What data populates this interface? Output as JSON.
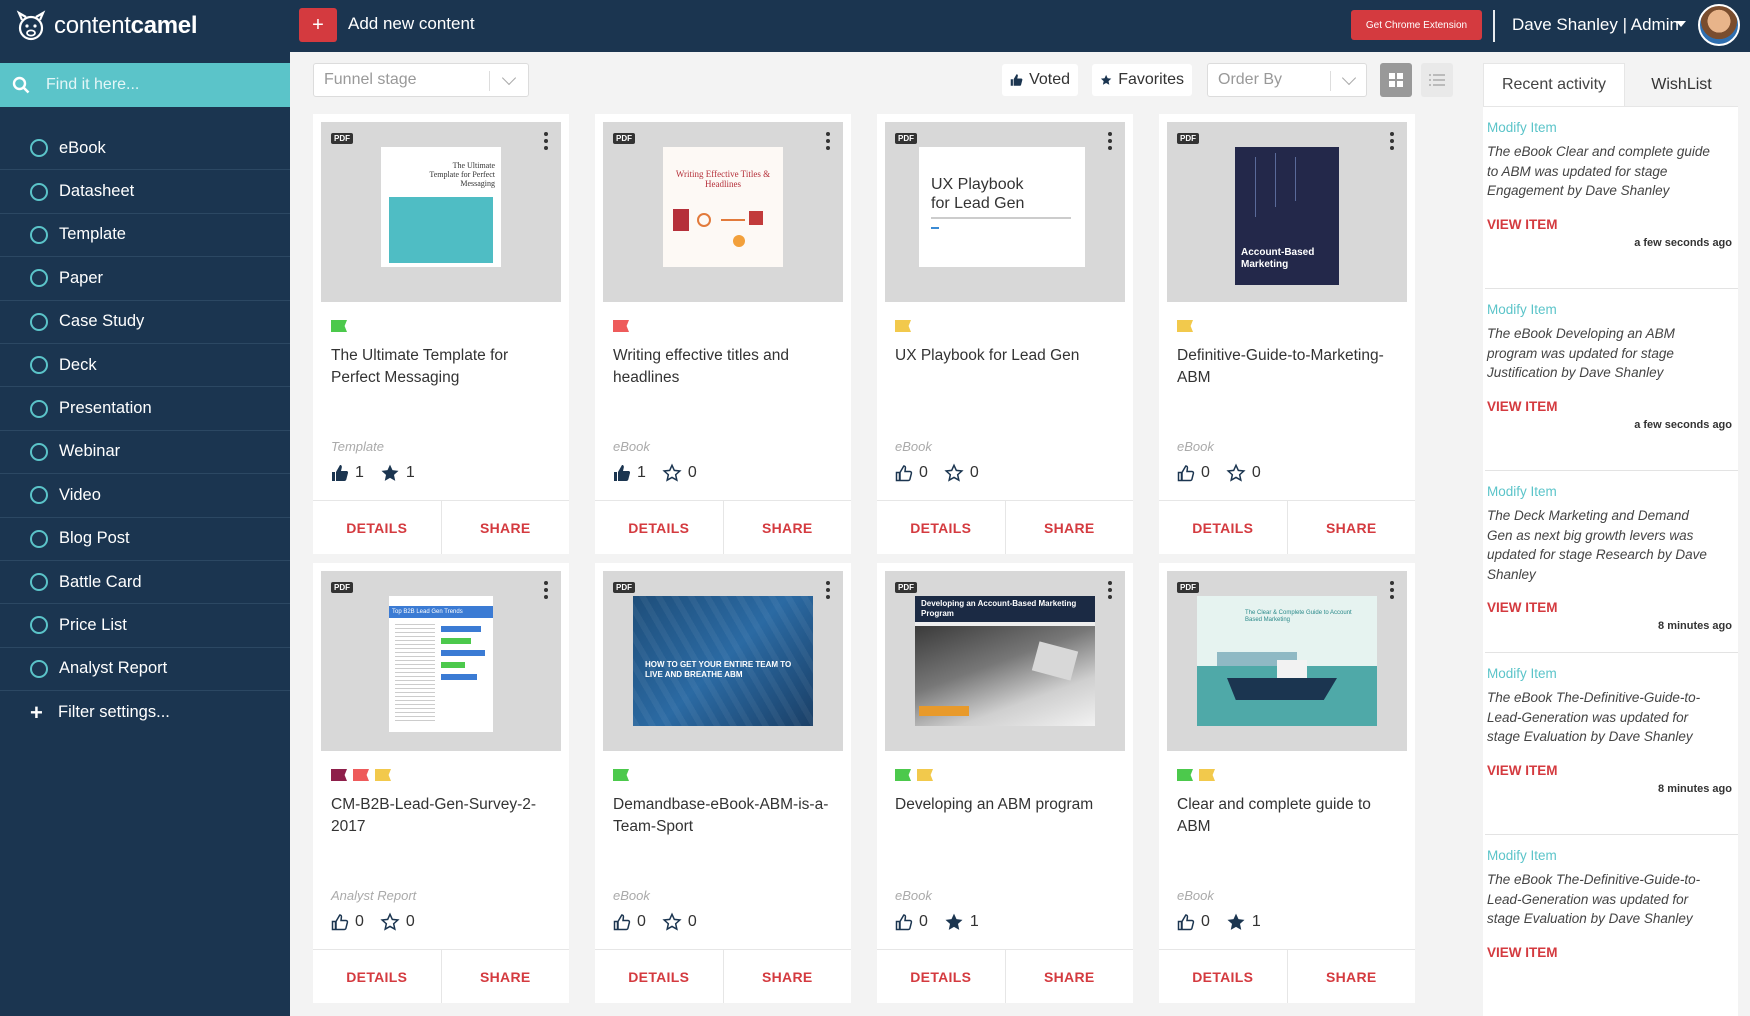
{
  "header": {
    "logo_light": "content",
    "logo_bold": "camel",
    "add_button_icon": "+",
    "add_label": "Add new content",
    "chrome_extension": "Get Chrome Extension",
    "user_label": "Dave Shanley | Admin"
  },
  "sidebar": {
    "search_placeholder": "Find it here...",
    "categories": [
      "eBook",
      "Datasheet",
      "Template",
      "Paper",
      "Case Study",
      "Deck",
      "Presentation",
      "Webinar",
      "Video",
      "Blog Post",
      "Battle Card",
      "Price List",
      "Analyst Report"
    ],
    "filter_settings": "Filter settings..."
  },
  "toolbar": {
    "funnel_stage": "Funnel stage",
    "voted": "Voted",
    "favorites": "Favorites",
    "order_by": "Order By"
  },
  "cards": [
    {
      "file_badge": "PDF",
      "title": "The Ultimate Template for Perfect Messaging",
      "type": "Template",
      "votes": "1",
      "favorites": "1",
      "voted": true,
      "favorited": true,
      "tags": [
        "#4cc94c"
      ],
      "cover_text": "The Ultimate Template for Perfect Messaging",
      "details": "DETAILS",
      "share": "SHARE"
    },
    {
      "file_badge": "PDF",
      "title": "Writing effective titles and headlines",
      "type": "eBook",
      "votes": "1",
      "favorites": "0",
      "voted": true,
      "favorited": false,
      "tags": [
        "#ee5b5b"
      ],
      "cover_text": "Writing Effective Titles & Headlines",
      "details": "DETAILS",
      "share": "SHARE"
    },
    {
      "file_badge": "PDF",
      "title": "UX Playbook for Lead Gen",
      "type": "eBook",
      "votes": "0",
      "favorites": "0",
      "voted": false,
      "favorited": false,
      "tags": [
        "#f2c94c"
      ],
      "cover_text": "UX Playbook for Lead Gen",
      "details": "DETAILS",
      "share": "SHARE"
    },
    {
      "file_badge": "PDF",
      "title": "Definitive-Guide-to-Marketing-ABM",
      "type": "eBook",
      "votes": "0",
      "favorites": "0",
      "voted": false,
      "favorited": false,
      "tags": [
        "#f2c94c"
      ],
      "cover_text": "Account-Based Marketing",
      "details": "DETAILS",
      "share": "SHARE"
    },
    {
      "file_badge": "PDF",
      "title": "CM-B2B-Lead-Gen-Survey-2-2017",
      "type": "Analyst Report",
      "votes": "0",
      "favorites": "0",
      "voted": false,
      "favorited": false,
      "tags": [
        "#8e1f4a",
        "#ee5b5b",
        "#f2c94c"
      ],
      "cover_text": "Top B2B Lead Gen Trends",
      "details": "DETAILS",
      "share": "SHARE"
    },
    {
      "file_badge": "PDF",
      "title": "Demandbase-eBook-ABM-is-a-Team-Sport",
      "type": "eBook",
      "votes": "0",
      "favorites": "0",
      "voted": false,
      "favorited": false,
      "tags": [
        "#4cc94c"
      ],
      "cover_text": "HOW TO GET YOUR ENTIRE TEAM TO LIVE AND BREATHE ABM",
      "details": "DETAILS",
      "share": "SHARE"
    },
    {
      "file_badge": "PDF",
      "title": "Developing an ABM program",
      "type": "eBook",
      "votes": "0",
      "favorites": "1",
      "voted": false,
      "favorited": true,
      "tags": [
        "#4cc94c",
        "#f2c94c"
      ],
      "cover_text": "Developing an Account-Based Marketing Program",
      "details": "DETAILS",
      "share": "SHARE"
    },
    {
      "file_badge": "PDF",
      "title": "Clear and complete guide to ABM",
      "type": "eBook",
      "votes": "0",
      "favorites": "1",
      "voted": false,
      "favorited": true,
      "tags": [
        "#4cc94c",
        "#f2c94c"
      ],
      "cover_text": "The Clear & Complete Guide to Account Based Marketing",
      "details": "DETAILS",
      "share": "SHARE"
    }
  ],
  "activity": {
    "tabs": [
      "Recent activity",
      "WishList"
    ],
    "items": [
      {
        "head": "Modify Item",
        "body": "The eBook Clear and complete guide to ABM was updated for stage Engagement by Dave Shanley",
        "view": "VIEW ITEM",
        "time": "a few seconds ago"
      },
      {
        "head": "Modify Item",
        "body": "The eBook Developing an ABM program was updated for stage Justification by Dave Shanley",
        "view": "VIEW ITEM",
        "time": "a few seconds ago"
      },
      {
        "head": "Modify Item",
        "body": "The Deck Marketing and Demand Gen as next big growth levers was updated for stage Research by Dave Shanley",
        "view": "VIEW ITEM",
        "time": "8 minutes ago"
      },
      {
        "head": "Modify Item",
        "body": "The eBook The-Definitive-Guide-to-Lead-Generation was updated for stage Evaluation by Dave Shanley",
        "view": "VIEW ITEM",
        "time": "8 minutes ago"
      },
      {
        "head": "Modify Item",
        "body": "The eBook The-Definitive-Guide-to-Lead-Generation was updated for stage Evaluation by Dave Shanley",
        "view": "VIEW ITEM",
        "time": ""
      }
    ]
  },
  "colors": {
    "navy": "#1b3550",
    "teal": "#5bc4c9",
    "red": "#d43a3f"
  }
}
